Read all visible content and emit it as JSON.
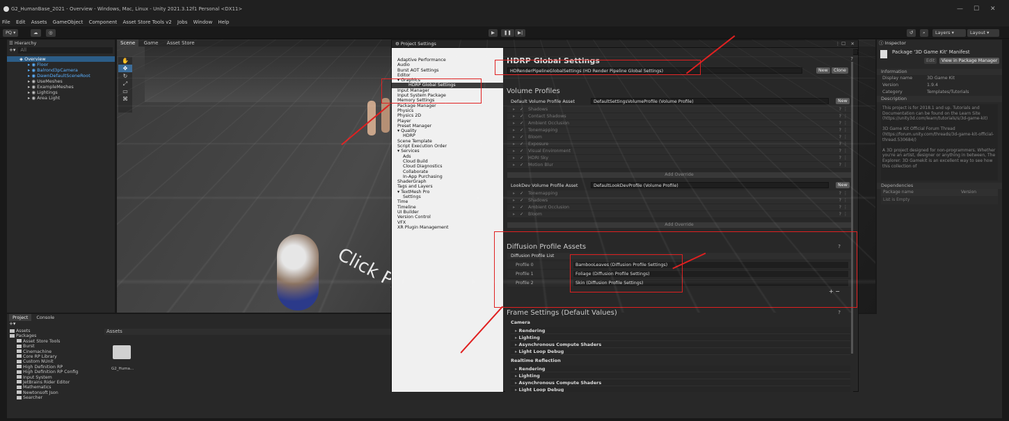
{
  "window": {
    "title": "G2_HumanBase_2021 - Overview - Windows, Mac, Linux - Unity 2021.3.12f1 Personal <DX11>",
    "controls": [
      "—",
      "☐",
      "✕"
    ]
  },
  "menu": [
    "File",
    "Edit",
    "Assets",
    "GameObject",
    "Component",
    "Asset Store Tools v2",
    "Jobs",
    "Window",
    "Help"
  ],
  "toolbar": {
    "account": "PQ ▾",
    "play": "▶",
    "pause": "❚❚",
    "step": "▶|",
    "layers": "Layers",
    "layout": "Layout"
  },
  "hierarchy": {
    "tab": "Hierarchy",
    "search_placeholder": "All",
    "items": [
      {
        "label": "Overview",
        "level": 0,
        "selected": true
      },
      {
        "label": "Floor",
        "level": 1,
        "prefab": true
      },
      {
        "label": "Balrond3pCamera",
        "level": 1,
        "prefab": true
      },
      {
        "label": "DawnDefaultSceneRoot",
        "level": 1,
        "prefab": true
      },
      {
        "label": "UseMeshes",
        "level": 1,
        "prefab": false
      },
      {
        "label": "ExampleMeshes",
        "level": 1,
        "prefab": false
      },
      {
        "label": "Lightings",
        "level": 1,
        "prefab": false
      },
      {
        "label": "Area Light",
        "level": 1,
        "prefab": false
      }
    ]
  },
  "scene_tabs": [
    "Scene",
    "Game",
    "Asset Store"
  ],
  "scene_overlay_text": "Click Play to",
  "project": {
    "tabs": [
      "Project",
      "Console"
    ],
    "tree": [
      {
        "label": "Assets",
        "level": 0
      },
      {
        "label": "Packages",
        "level": 0
      },
      {
        "label": "Asset Store Tools",
        "level": 1
      },
      {
        "label": "Burst",
        "level": 1
      },
      {
        "label": "Cinemachine",
        "level": 1
      },
      {
        "label": "Core RP Library",
        "level": 1
      },
      {
        "label": "Custom NUnit",
        "level": 1
      },
      {
        "label": "High Definition RP",
        "level": 1
      },
      {
        "label": "High Definition RP Config",
        "level": 1
      },
      {
        "label": "Input System",
        "level": 1
      },
      {
        "label": "JetBrains Rider Editor",
        "level": 1
      },
      {
        "label": "Mathematics",
        "level": 1
      },
      {
        "label": "Newtonsoft Json",
        "level": 1
      },
      {
        "label": "Searcher",
        "level": 1
      }
    ],
    "breadcrumb": "Assets",
    "asset_label": "G2_Huma..."
  },
  "project_settings": {
    "title": "Project Settings",
    "categories": [
      {
        "label": "Adaptive Performance",
        "type": "top"
      },
      {
        "label": "Audio",
        "type": "top"
      },
      {
        "label": "Burst AOT Settings",
        "type": "top"
      },
      {
        "label": "Editor",
        "type": "top"
      },
      {
        "label": "▾ Graphics",
        "type": "top"
      },
      {
        "label": "HDRP Global Settings",
        "type": "selected"
      },
      {
        "label": "Input Manager",
        "type": "top"
      },
      {
        "label": "Input System Package",
        "type": "top"
      },
      {
        "label": "Memory Settings",
        "type": "top"
      },
      {
        "label": "Package Manager",
        "type": "top"
      },
      {
        "label": "Physics",
        "type": "top"
      },
      {
        "label": "Physics 2D",
        "type": "top"
      },
      {
        "label": "Player",
        "type": "top"
      },
      {
        "label": "Preset Manager",
        "type": "top"
      },
      {
        "label": "▾ Quality",
        "type": "top"
      },
      {
        "label": "HDRP",
        "type": "sub"
      },
      {
        "label": "Scene Template",
        "type": "top"
      },
      {
        "label": "Script Execution Order",
        "type": "top"
      },
      {
        "label": "▾ Services",
        "type": "top"
      },
      {
        "label": "Ads",
        "type": "sub"
      },
      {
        "label": "Cloud Build",
        "type": "sub"
      },
      {
        "label": "Cloud Diagnostics",
        "type": "sub"
      },
      {
        "label": "Collaborate",
        "type": "sub"
      },
      {
        "label": "In-App Purchasing",
        "type": "sub"
      },
      {
        "label": "ShaderGraph",
        "type": "top"
      },
      {
        "label": "Tags and Layers",
        "type": "top"
      },
      {
        "label": "▾ TextMesh Pro",
        "type": "top"
      },
      {
        "label": "Settings",
        "type": "sub"
      },
      {
        "label": "Time",
        "type": "top"
      },
      {
        "label": "Timeline",
        "type": "top"
      },
      {
        "label": "UI Builder",
        "type": "top"
      },
      {
        "label": "Version Control",
        "type": "top"
      },
      {
        "label": "VFX",
        "type": "top"
      },
      {
        "label": "XR Plugin Management",
        "type": "top"
      }
    ],
    "content": {
      "heading": "HDRP Global Settings",
      "global_settings_field": "HDRenderPipelineGlobalSettings (HD Render Pipeline Global Settings)",
      "new_label": "New",
      "clone_label": "Clone",
      "volume_profiles_title": "Volume Profiles",
      "default_profile_label": "Default Volume Profile Asset",
      "default_profile_value": "DefaultSettingsVolumeProfile (Volume Profile)",
      "default_overrides": [
        "Shadows",
        "Contact Shadows",
        "Ambient Occlusion",
        "Tonemapping",
        "Bloom",
        "Exposure",
        "Visual Environment",
        "HDRI Sky",
        "Motion Blur"
      ],
      "add_override_label": "Add Override",
      "lookdev_label": "LookDev Volume Profile Asset",
      "lookdev_value": "DefaultLookDevProfile (Volume Profile)",
      "lookdev_overrides": [
        "Tonemapping",
        "Shadows",
        "Ambient Occlusion",
        "Bloom"
      ],
      "diffusion_title": "Diffusion Profile Assets",
      "diffusion_list_label": "Diffusion Profile List",
      "diffusion_profiles": [
        {
          "name": "Profile 0",
          "value": "BambooLeaves (Diffusion Profile Settings)"
        },
        {
          "name": "Profile 1",
          "value": "Foliage (Diffusion Profile Settings)"
        },
        {
          "name": "Profile 2",
          "value": "Skin (Diffusion Profile Settings)"
        }
      ],
      "plus_minus": "+  −",
      "frame_settings_title": "Frame Settings (Default Values)",
      "camera_label": "Camera",
      "camera_rows": [
        "Rendering",
        "Lighting",
        "Asynchronous Compute Shaders",
        "Light Loop Debug"
      ],
      "realtime_label": "Realtime Reflection",
      "realtime_rows": [
        "Rendering",
        "Lighting",
        "Asynchronous Compute Shaders",
        "Light Loop Debug"
      ]
    }
  },
  "inspector": {
    "tab": "Inspector",
    "title": "Package '3D Game Kit' Manifest",
    "edit_label": "Edit",
    "view_label": "View in Package Manager",
    "info_title": "Information",
    "info_rows": [
      {
        "k": "Display name",
        "v": "3D Game Kit"
      },
      {
        "k": "Version",
        "v": "1.9.4"
      },
      {
        "k": "Category",
        "v": "Templates/Tutorials"
      }
    ],
    "description_title": "Description",
    "description": "This project is for 2018.1 and up. Tutorials and Documentation can be found on the Learn Site (https://unity3d.com/learn/tutorials/s/3d-game-kit)\n\n3D Game Kit Official Forum Thread (https://forum.unity.com/threads/3d-game-kit-official-thread.530684/)\n\nA 3D project designed for non-programmers. Whether you're an artist, designer or anything in between, The Explorer: 3D Gamekit is an excellent way to see how this collection of",
    "dependencies_title": "Dependencies",
    "dep_col1": "Package name",
    "dep_col2": "Version",
    "dep_empty": "List is Empty"
  },
  "colors": {
    "annotation": "#e02020",
    "selection": "#2c5d87"
  }
}
